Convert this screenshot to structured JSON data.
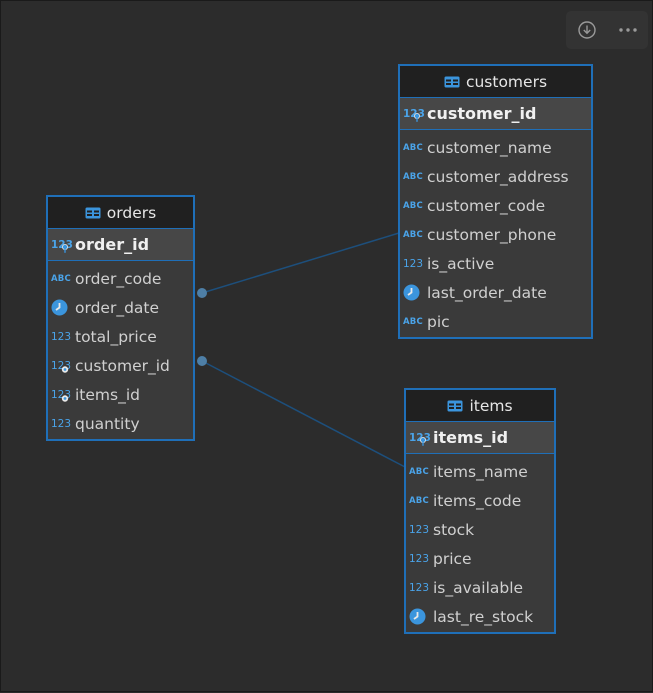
{
  "toolbar": {
    "download_icon": "download-icon",
    "more_icon": "more-icon"
  },
  "colors": {
    "accent": "#1f6fb8",
    "type_icon": "#4aa3e8",
    "header_bg": "#202020",
    "row_bg": "#3a3a3a"
  },
  "tables": {
    "orders": {
      "name": "orders",
      "pk": {
        "label": "order_id",
        "type": "123"
      },
      "columns": [
        {
          "label": "order_code",
          "type": "ABC"
        },
        {
          "label": "order_date",
          "type": "clock"
        },
        {
          "label": "total_price",
          "type": "123"
        },
        {
          "label": "customer_id",
          "type": "123-fk"
        },
        {
          "label": "items_id",
          "type": "123-fk"
        },
        {
          "label": "quantity",
          "type": "123"
        }
      ]
    },
    "customers": {
      "name": "customers",
      "pk": {
        "label": "customer_id",
        "type": "123"
      },
      "columns": [
        {
          "label": "customer_name",
          "type": "ABC"
        },
        {
          "label": "customer_address",
          "type": "ABC"
        },
        {
          "label": "customer_code",
          "type": "ABC"
        },
        {
          "label": "customer_phone",
          "type": "ABC"
        },
        {
          "label": "is_active",
          "type": "123"
        },
        {
          "label": "last_order_date",
          "type": "clock"
        },
        {
          "label": "pic",
          "type": "ABC"
        }
      ]
    },
    "items": {
      "name": "items",
      "pk": {
        "label": "items_id",
        "type": "123"
      },
      "columns": [
        {
          "label": "items_name",
          "type": "ABC"
        },
        {
          "label": "items_code",
          "type": "ABC"
        },
        {
          "label": "stock",
          "type": "123"
        },
        {
          "label": "price",
          "type": "123"
        },
        {
          "label": "is_available",
          "type": "123"
        },
        {
          "label": "last_re_stock",
          "type": "clock"
        }
      ]
    }
  },
  "relations": [
    {
      "from": "orders.customer_id",
      "to": "customers.customer_id"
    },
    {
      "from": "orders.items_id",
      "to": "items.items_id"
    }
  ]
}
